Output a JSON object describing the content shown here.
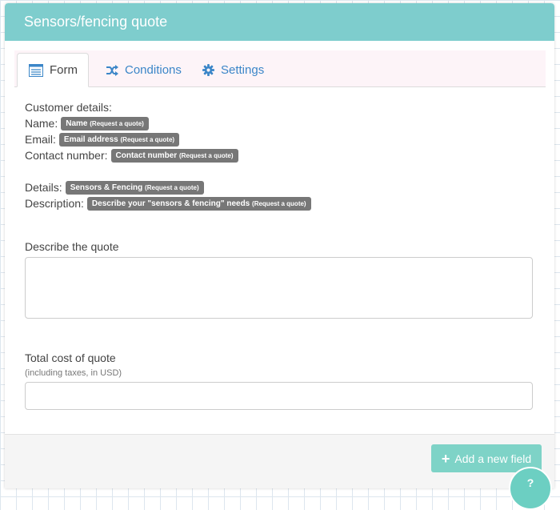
{
  "panel": {
    "title": "Sensors/fencing quote"
  },
  "tabs": [
    {
      "label": "Form",
      "icon": "form-icon"
    },
    {
      "label": "Conditions",
      "icon": "shuffle-icon"
    },
    {
      "label": "Settings",
      "icon": "gear-icon"
    }
  ],
  "details": {
    "heading": "Customer details:",
    "name": {
      "label": "Name:",
      "badge": "Name",
      "badge_note": "(Request a quote)"
    },
    "email": {
      "label": "Email:",
      "badge": "Email address",
      "badge_note": "(Request a quote)"
    },
    "contact": {
      "label": "Contact number:",
      "badge": "Contact number",
      "badge_note": "(Request a quote)"
    },
    "details": {
      "label": "Details:",
      "badge": "Sensors & Fencing",
      "badge_note": "(Request a quote)"
    },
    "description": {
      "label": "Description:",
      "badge": "Describe your \"sensors & fencing\" needs",
      "badge_note": "(Request a quote)"
    }
  },
  "fields": {
    "describe": {
      "label": "Describe the quote",
      "value": ""
    },
    "cost": {
      "label": "Total cost of quote",
      "help": "(including taxes, in USD)",
      "value": ""
    }
  },
  "footer": {
    "add_label": "Add a new field"
  },
  "help_button": {
    "label": "?"
  },
  "colors": {
    "header": "#7ecdcd",
    "link": "#3b86c8",
    "badge": "#777777",
    "add_button": "#7ed3c7"
  }
}
